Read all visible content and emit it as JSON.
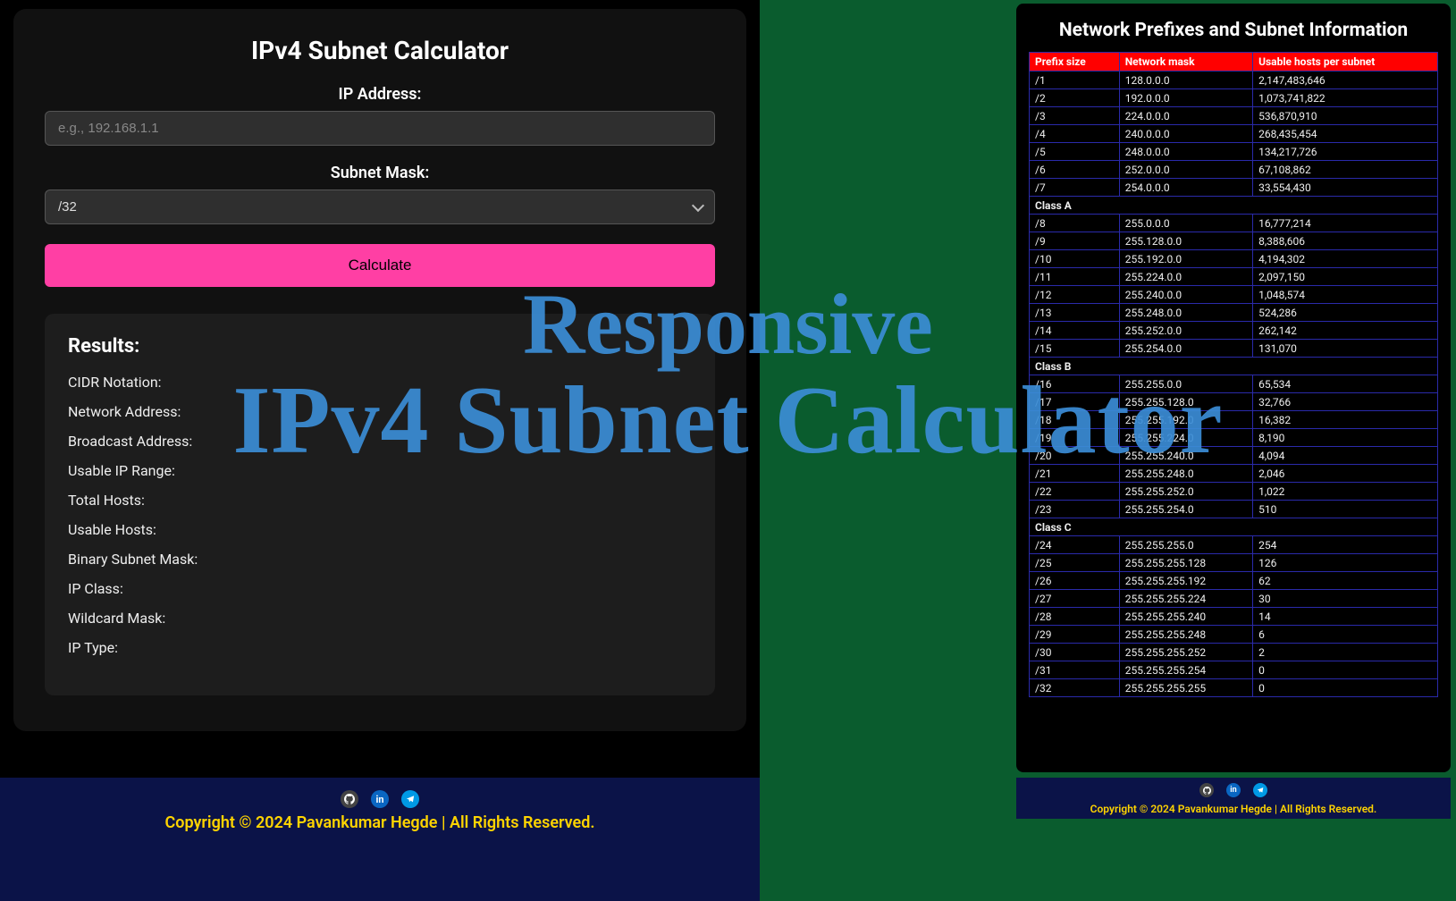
{
  "calc": {
    "title": "IPv4 Subnet Calculator",
    "ip_label": "IP Address:",
    "ip_placeholder": "e.g., 192.168.1.1",
    "mask_label": "Subnet Mask:",
    "mask_value": "/32",
    "button": "Calculate"
  },
  "results": {
    "heading": "Results:",
    "rows": [
      "CIDR Notation:",
      "Network Address:",
      "Broadcast Address:",
      "Usable IP Range:",
      "Total Hosts:",
      "Usable Hosts:",
      "Binary Subnet Mask:",
      "IP Class:",
      "Wildcard Mask:",
      "IP Type:"
    ]
  },
  "table": {
    "title": "Network Prefixes and Subnet Information",
    "headers": [
      "Prefix size",
      "Network mask",
      "Usable hosts per subnet"
    ],
    "rows": [
      {
        "t": "d",
        "c": [
          "/1",
          "128.0.0.0",
          "2,147,483,646"
        ]
      },
      {
        "t": "d",
        "c": [
          "/2",
          "192.0.0.0",
          "1,073,741,822"
        ]
      },
      {
        "t": "d",
        "c": [
          "/3",
          "224.0.0.0",
          "536,870,910"
        ]
      },
      {
        "t": "d",
        "c": [
          "/4",
          "240.0.0.0",
          "268,435,454"
        ]
      },
      {
        "t": "d",
        "c": [
          "/5",
          "248.0.0.0",
          "134,217,726"
        ]
      },
      {
        "t": "d",
        "c": [
          "/6",
          "252.0.0.0",
          "67,108,862"
        ]
      },
      {
        "t": "d",
        "c": [
          "/7",
          "254.0.0.0",
          "33,554,430"
        ]
      },
      {
        "t": "h",
        "c": [
          "Class A"
        ]
      },
      {
        "t": "d",
        "c": [
          "/8",
          "255.0.0.0",
          "16,777,214"
        ]
      },
      {
        "t": "d",
        "c": [
          "/9",
          "255.128.0.0",
          "8,388,606"
        ]
      },
      {
        "t": "d",
        "c": [
          "/10",
          "255.192.0.0",
          "4,194,302"
        ]
      },
      {
        "t": "d",
        "c": [
          "/11",
          "255.224.0.0",
          "2,097,150"
        ]
      },
      {
        "t": "d",
        "c": [
          "/12",
          "255.240.0.0",
          "1,048,574"
        ]
      },
      {
        "t": "d",
        "c": [
          "/13",
          "255.248.0.0",
          "524,286"
        ]
      },
      {
        "t": "d",
        "c": [
          "/14",
          "255.252.0.0",
          "262,142"
        ]
      },
      {
        "t": "d",
        "c": [
          "/15",
          "255.254.0.0",
          "131,070"
        ]
      },
      {
        "t": "h",
        "c": [
          "Class B"
        ]
      },
      {
        "t": "d",
        "c": [
          "/16",
          "255.255.0.0",
          "65,534"
        ]
      },
      {
        "t": "d",
        "c": [
          "/17",
          "255.255.128.0",
          "32,766"
        ]
      },
      {
        "t": "d",
        "c": [
          "/18",
          "255.255.192.0",
          "16,382"
        ]
      },
      {
        "t": "d",
        "c": [
          "/19",
          "255.255.224.0",
          "8,190"
        ]
      },
      {
        "t": "d",
        "c": [
          "/20",
          "255.255.240.0",
          "4,094"
        ]
      },
      {
        "t": "d",
        "c": [
          "/21",
          "255.255.248.0",
          "2,046"
        ]
      },
      {
        "t": "d",
        "c": [
          "/22",
          "255.255.252.0",
          "1,022"
        ]
      },
      {
        "t": "d",
        "c": [
          "/23",
          "255.255.254.0",
          "510"
        ]
      },
      {
        "t": "h",
        "c": [
          "Class C"
        ]
      },
      {
        "t": "d",
        "c": [
          "/24",
          "255.255.255.0",
          "254"
        ]
      },
      {
        "t": "d",
        "c": [
          "/25",
          "255.255.255.128",
          "126"
        ]
      },
      {
        "t": "d",
        "c": [
          "/26",
          "255.255.255.192",
          "62"
        ]
      },
      {
        "t": "d",
        "c": [
          "/27",
          "255.255.255.224",
          "30"
        ]
      },
      {
        "t": "d",
        "c": [
          "/28",
          "255.255.255.240",
          "14"
        ]
      },
      {
        "t": "d",
        "c": [
          "/29",
          "255.255.255.248",
          "6"
        ]
      },
      {
        "t": "d",
        "c": [
          "/30",
          "255.255.255.252",
          "2"
        ]
      },
      {
        "t": "d",
        "c": [
          "/31",
          "255.255.255.254",
          "0"
        ]
      },
      {
        "t": "d",
        "c": [
          "/32",
          "255.255.255.255",
          "0"
        ]
      }
    ]
  },
  "footer": {
    "copyright": "Copyright © 2024 Pavankumar Hegde | All Rights Reserved."
  },
  "watermark": {
    "line1": "Responsive",
    "line2": "IPv4 Subnet Calculator"
  }
}
